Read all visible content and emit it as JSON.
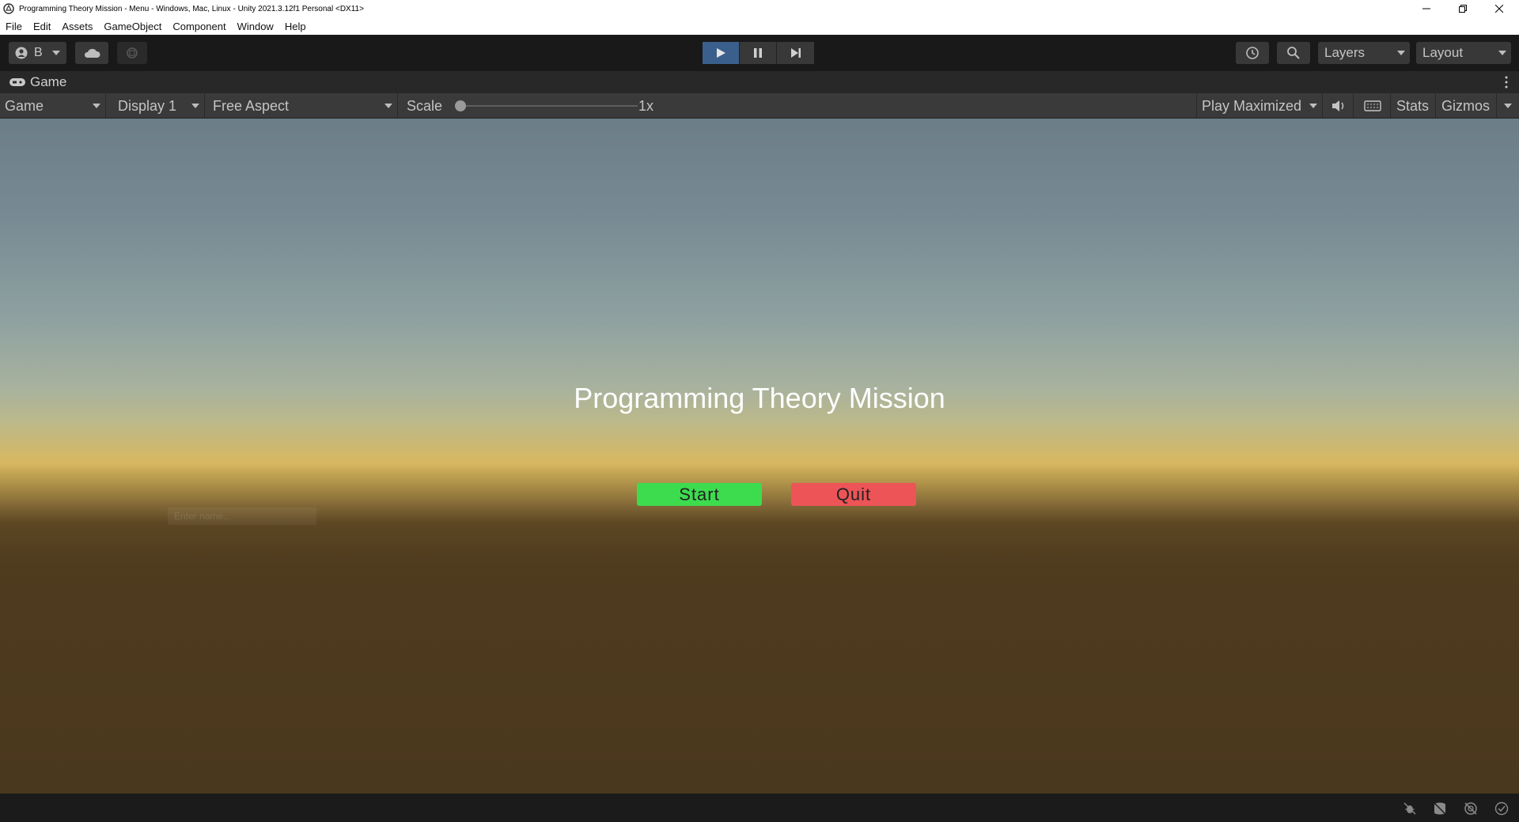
{
  "window": {
    "title": "Programming Theory Mission - Menu - Windows, Mac, Linux - Unity 2021.3.12f1 Personal <DX11>"
  },
  "menu": {
    "items": [
      "File",
      "Edit",
      "Assets",
      "GameObject",
      "Component",
      "Window",
      "Help"
    ]
  },
  "toolbar": {
    "account_label": "B",
    "layers_label": "Layers",
    "layout_label": "Layout"
  },
  "tab": {
    "label": "Game"
  },
  "game_toolbar": {
    "view_select": "Game",
    "display_select": "Display 1",
    "aspect_select": "Free Aspect",
    "scale_label": "Scale",
    "scale_value": "1x",
    "scale_level": 0.0,
    "play_mode_select": "Play Maximized",
    "stats_label": "Stats",
    "gizmos_label": "Gizmos"
  },
  "game": {
    "title": "Programming Theory Mission",
    "start_label": "Start",
    "quit_label": "Quit",
    "start_color": "#3ddc4f",
    "quit_color": "#ec5457",
    "ghost_input_placeholder": "Enter name..."
  },
  "colors": {
    "play_active": "#3a5f8c",
    "toolbar_bg": "#191919"
  }
}
